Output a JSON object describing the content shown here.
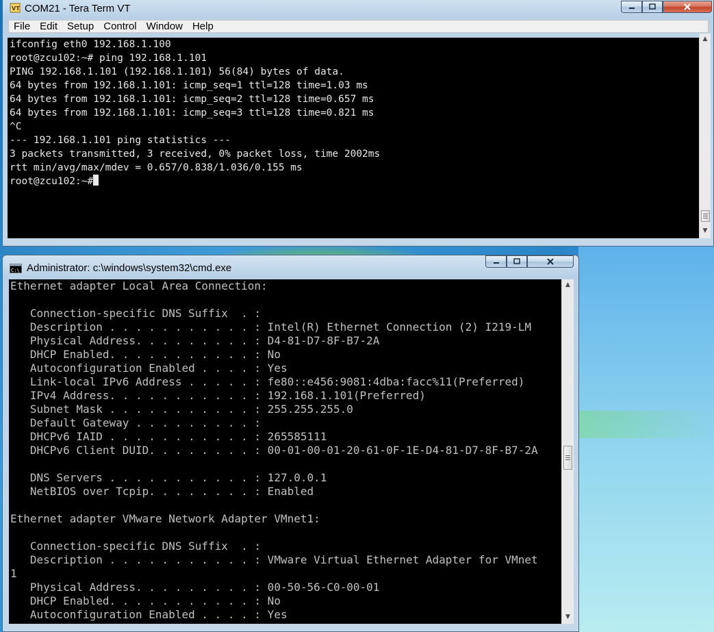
{
  "teraterm": {
    "title": "COM21 - Tera Term VT",
    "menu": [
      "File",
      "Edit",
      "Setup",
      "Control",
      "Window",
      "Help"
    ],
    "lines": [
      "ifconfig eth0 192.168.1.100",
      "root@zcu102:~# ping 192.168.1.101",
      "PING 192.168.1.101 (192.168.1.101) 56(84) bytes of data.",
      "64 bytes from 192.168.1.101: icmp_seq=1 ttl=128 time=1.03 ms",
      "64 bytes from 192.168.1.101: icmp_seq=2 ttl=128 time=0.657 ms",
      "64 bytes from 192.168.1.101: icmp_seq=3 ttl=128 time=0.821 ms",
      "^C",
      "--- 192.168.1.101 ping statistics ---",
      "3 packets transmitted, 3 received, 0% packet loss, time 2002ms",
      "rtt min/avg/max/mdev = 0.657/0.838/1.036/0.155 ms",
      "root@zcu102:~#"
    ]
  },
  "cmd": {
    "title": "Administrator: c:\\windows\\system32\\cmd.exe",
    "lines": [
      "Ethernet adapter Local Area Connection:",
      "",
      "   Connection-specific DNS Suffix  . :",
      "   Description . . . . . . . . . . . : Intel(R) Ethernet Connection (2) I219-LM",
      "   Physical Address. . . . . . . . . : D4-81-D7-8F-B7-2A",
      "   DHCP Enabled. . . . . . . . . . . : No",
      "   Autoconfiguration Enabled . . . . : Yes",
      "   Link-local IPv6 Address . . . . . : fe80::e456:9081:4dba:facc%11(Preferred)",
      "   IPv4 Address. . . . . . . . . . . : 192.168.1.101(Preferred)",
      "   Subnet Mask . . . . . . . . . . . : 255.255.255.0",
      "   Default Gateway . . . . . . . . . :",
      "   DHCPv6 IAID . . . . . . . . . . . : 265585111",
      "   DHCPv6 Client DUID. . . . . . . . : 00-01-00-01-20-61-0F-1E-D4-81-D7-8F-B7-2A",
      "",
      "   DNS Servers . . . . . . . . . . . : 127.0.0.1",
      "   NetBIOS over Tcpip. . . . . . . . : Enabled",
      "",
      "Ethernet adapter VMware Network Adapter VMnet1:",
      "",
      "   Connection-specific DNS Suffix  . :",
      "   Description . . . . . . . . . . . : VMware Virtual Ethernet Adapter for VMnet",
      "1",
      "   Physical Address. . . . . . . . . : 00-50-56-C0-00-01",
      "   DHCP Enabled. . . . . . . . . . . : No",
      "   Autoconfiguration Enabled . . . . : Yes"
    ]
  }
}
